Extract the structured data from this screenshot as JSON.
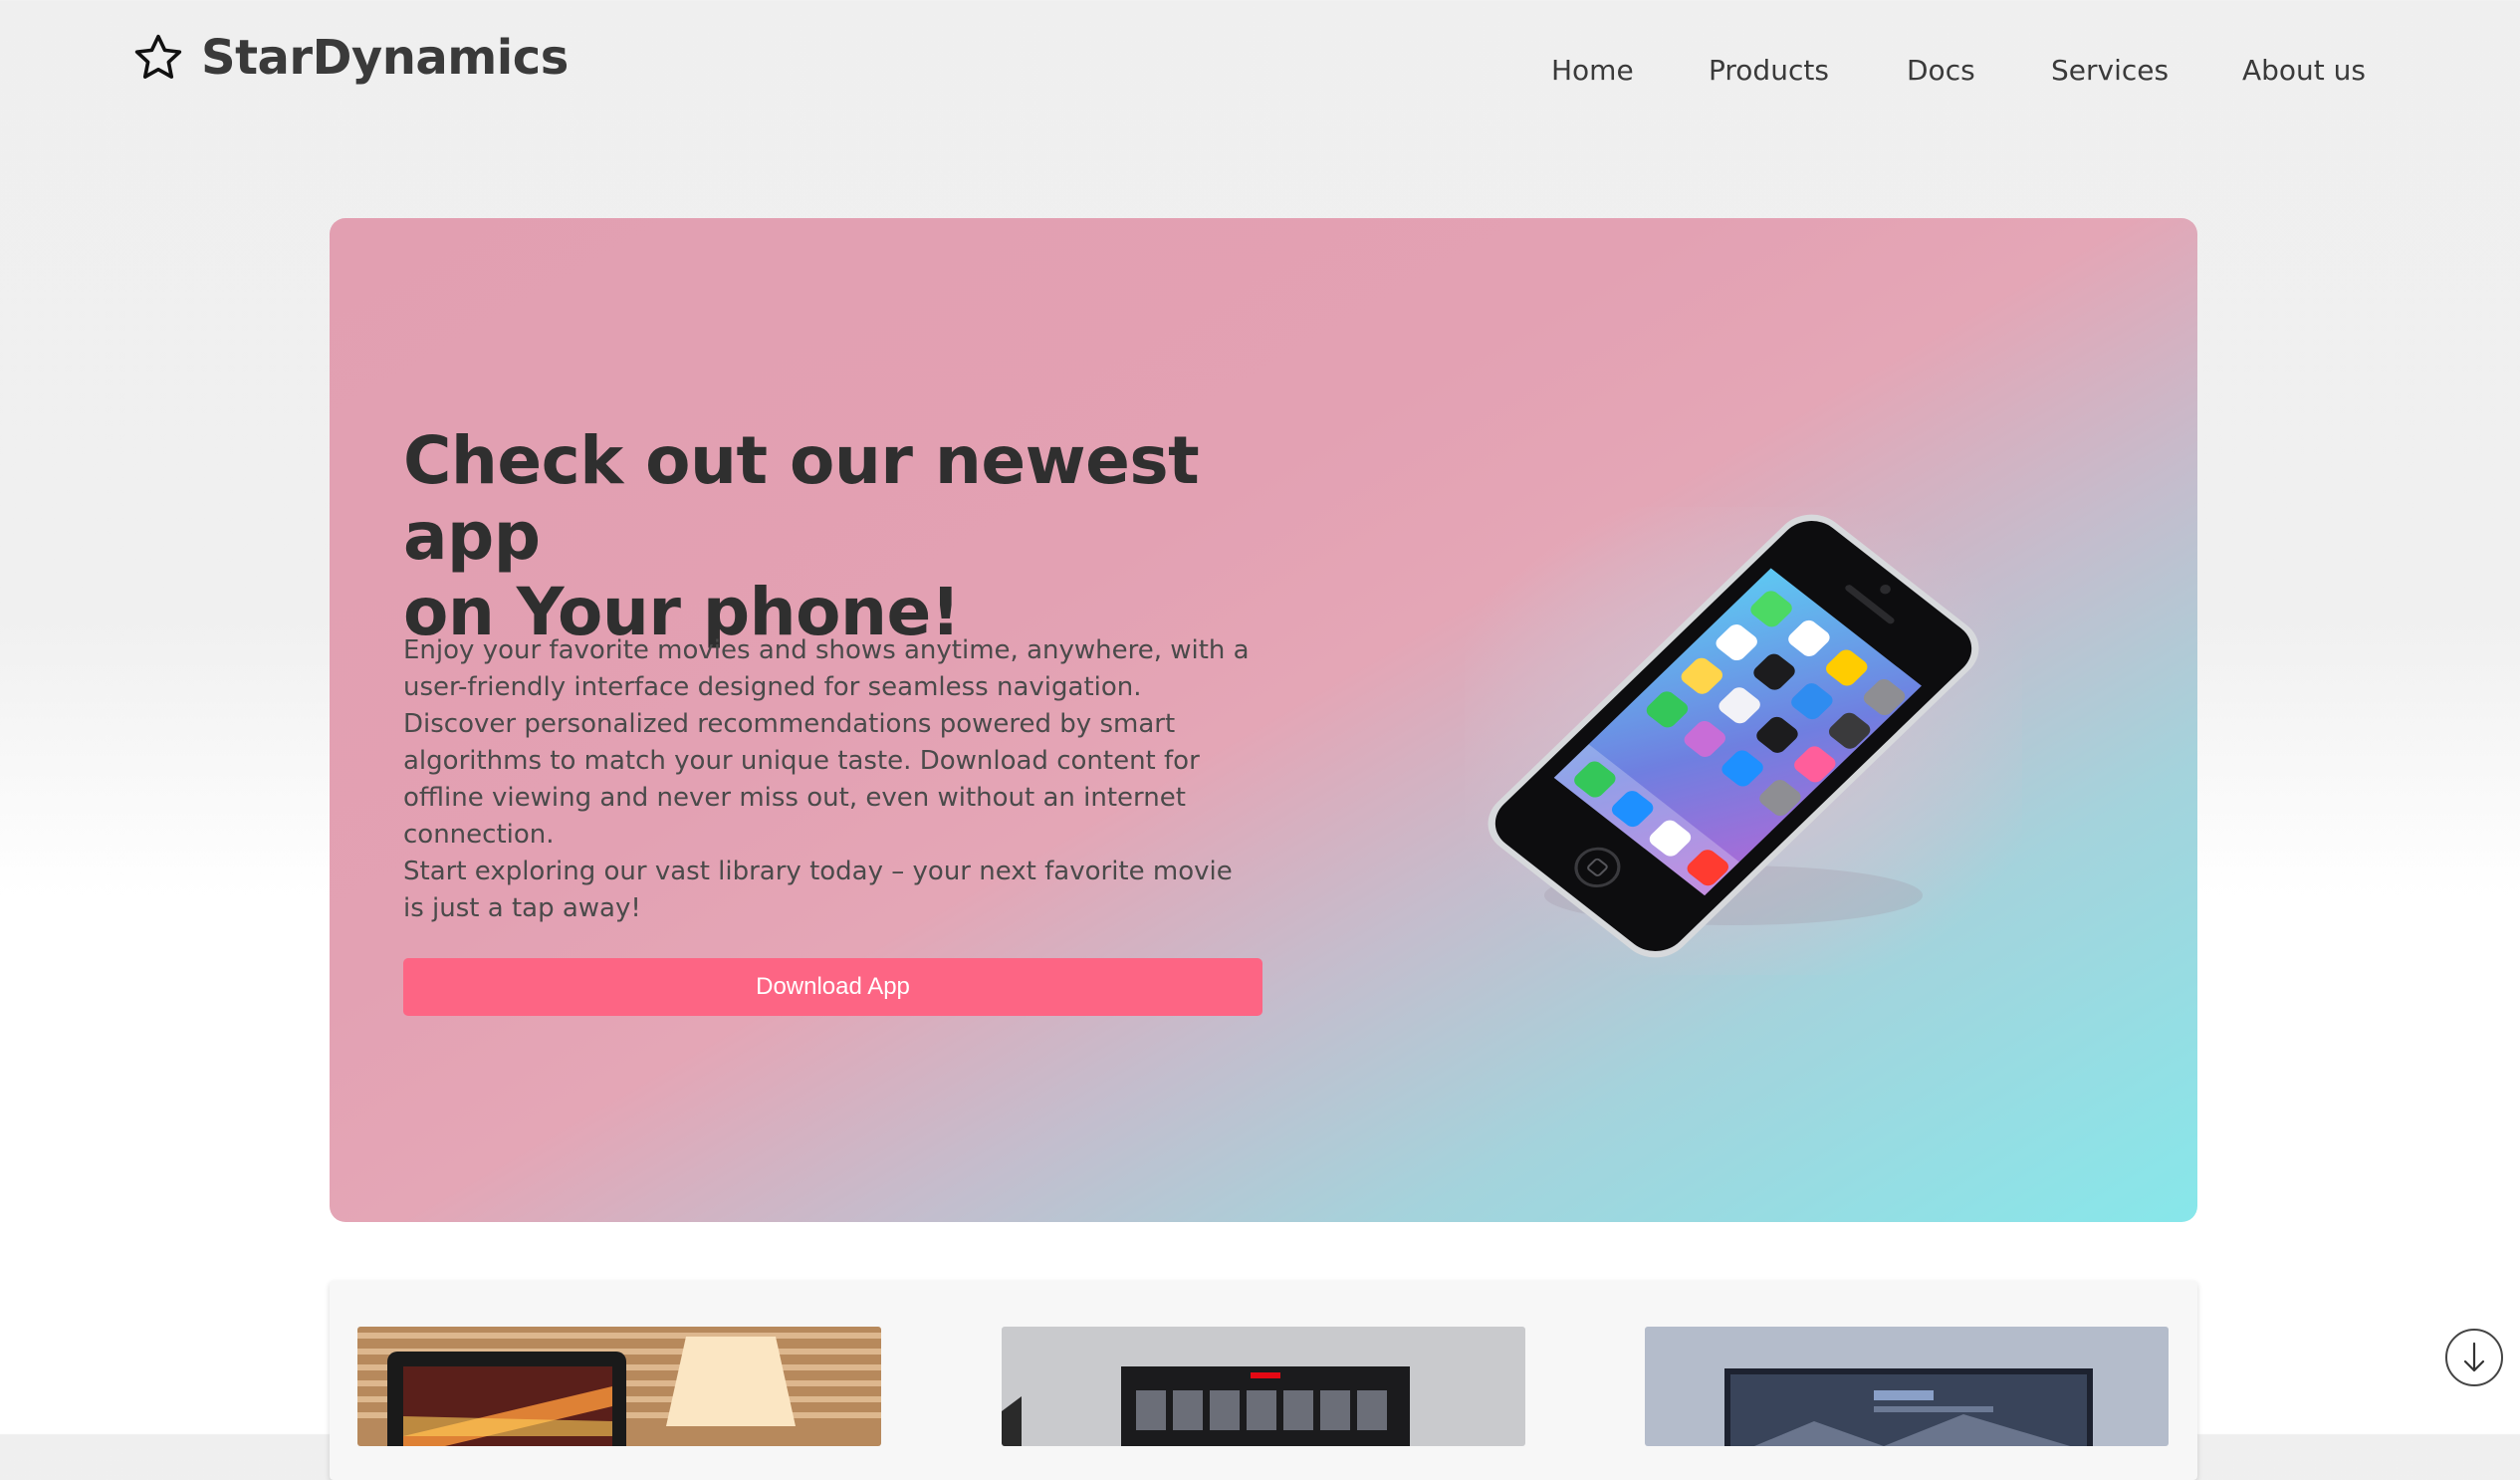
{
  "header": {
    "brand_name": "StarDynamics",
    "brand_icon": "star-outline-icon",
    "nav": [
      {
        "label": "Home"
      },
      {
        "label": "Products"
      },
      {
        "label": "Docs"
      },
      {
        "label": "Services"
      },
      {
        "label": "About us"
      }
    ]
  },
  "hero": {
    "title_line1": "Check out our newest app",
    "title_line2": "on Your phone!",
    "body": "Enjoy your favorite movies and shows anytime, anywhere, with a user-friendly interface designed for seamless navigation. Discover personalized recommendations powered by smart algorithms to match your unique taste. Download content for offline viewing and never miss out, even without an internet connection.",
    "body2": "Start exploring our vast library today – your next favorite movie is just a tap away!",
    "button_label": "Download App",
    "image_icon": "smartphone-icon",
    "colors": {
      "gradient_start": "#e29fb1",
      "gradient_end": "#87e7ea",
      "button": "#fd6584"
    }
  },
  "cards": [
    {
      "image_icon": "laptop-photo-icon"
    },
    {
      "image_icon": "tv-photo-icon"
    },
    {
      "image_icon": "monitor-photo-icon"
    }
  ],
  "scroll_button_icon": "arrow-down-icon"
}
